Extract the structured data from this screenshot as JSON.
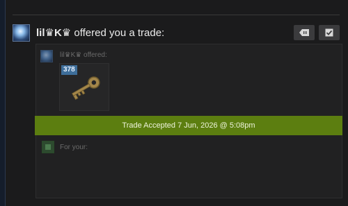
{
  "trade": {
    "sender_name": "lil♛K♛",
    "title_suffix": " offered you a trade:",
    "offered_label": "lil♛K♛ offered:",
    "for_your_label": "For your:",
    "status_text": "Trade Accepted 7 Jun, 2026 @ 5:08pm"
  },
  "item": {
    "badge": "378",
    "icon": "key-icon"
  },
  "actions": {
    "counter_icon": "counter-offer-icon",
    "accept_icon": "checkmark-icon"
  },
  "colors": {
    "background": "#1b1b1c",
    "panel": "#212122",
    "status_banner": "#5c7e10",
    "badge": "#3e6e9a",
    "button": "#3b3b3d"
  }
}
